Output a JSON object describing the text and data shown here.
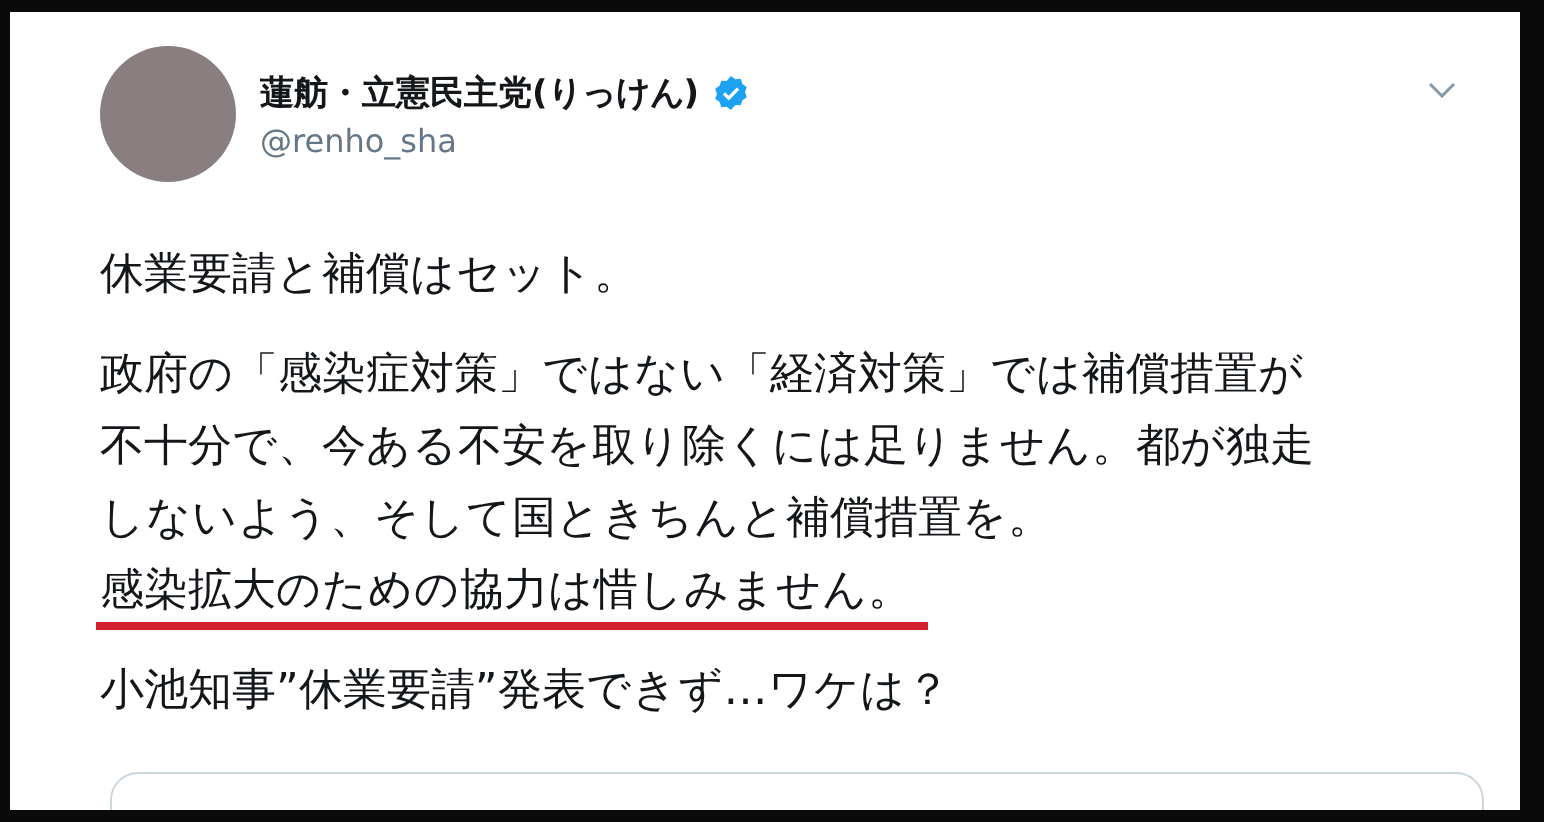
{
  "author": {
    "name": "蓮舫・立憲民主党(りっけん)",
    "verified": true,
    "handle": "@renho_sha"
  },
  "paragraphs": [
    {
      "lines": [
        {
          "text": "休業要請と補償はセット。",
          "underlined": false
        }
      ]
    },
    {
      "lines": [
        {
          "text": "政府の「感染症対策」ではない「経済対策」では補償措置が",
          "underlined": false
        },
        {
          "text": "不十分で、今ある不安を取り除くには足りません。都が独走",
          "underlined": false
        },
        {
          "text": "しないよう、そして国ときちんと補償措置を。",
          "underlined": false
        },
        {
          "text": "感染拡大のための協力は惜しみません。",
          "underlined": true
        }
      ]
    },
    {
      "lines": [
        {
          "text": "小池知事”休業要請”発表できず…ワケは？",
          "underlined": false
        }
      ]
    }
  ]
}
